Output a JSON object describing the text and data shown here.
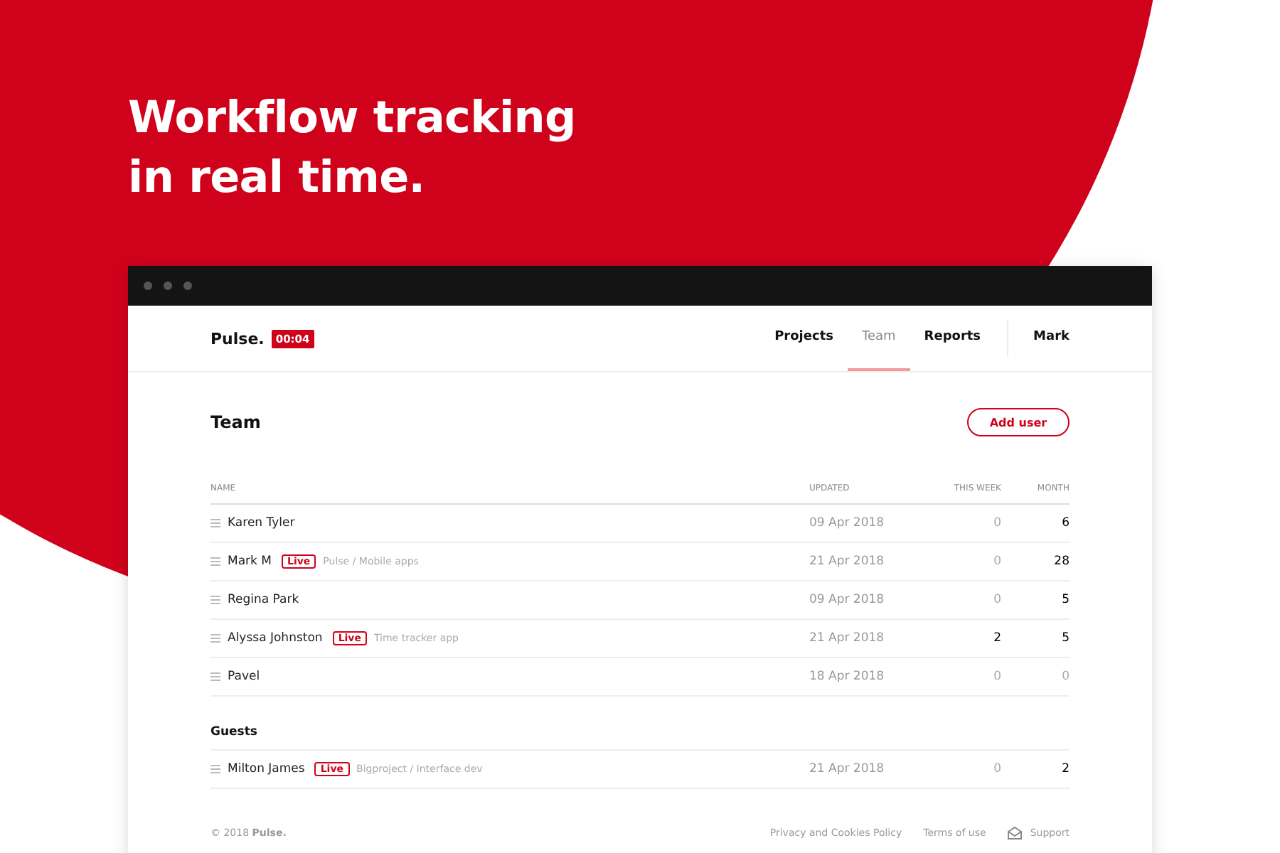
{
  "headline": [
    "Workflow tracking",
    "in real time."
  ],
  "app": {
    "brand": "Pulse.",
    "timer": "00:04",
    "nav": [
      {
        "label": "Projects",
        "selected": false
      },
      {
        "label": "Team",
        "selected": true
      },
      {
        "label": "Reports",
        "selected": false
      }
    ],
    "user": "Mark",
    "page_title": "Team",
    "add_button": "Add user",
    "columns": [
      "NAME",
      "UPDATED",
      "THIS WEEK",
      "MONTH"
    ],
    "rows": [
      {
        "name": "Karen Tyler",
        "live": false,
        "updated": "09 Apr 2018",
        "week": {
          "value": "0",
          "muted": true
        },
        "month": {
          "value": "6",
          "muted": false
        }
      },
      {
        "name": "Mark M",
        "live": true,
        "badge": "Live",
        "project": "Pulse / Mobile apps",
        "updated": "21 Apr 2018",
        "week": {
          "value": "0",
          "muted": true
        },
        "month": {
          "value": "28",
          "muted": false
        }
      },
      {
        "name": "Regina Park",
        "live": false,
        "updated": "09 Apr 2018",
        "week": {
          "value": "0",
          "muted": true
        },
        "month": {
          "value": "5",
          "muted": false
        }
      },
      {
        "name": "Alyssa Johnston",
        "live": true,
        "badge": "Live",
        "project": "Time tracker app",
        "updated": "21 Apr 2018",
        "week": {
          "value": "2",
          "muted": false
        },
        "month": {
          "value": "5",
          "muted": false
        }
      },
      {
        "name": "Pavel",
        "live": false,
        "updated": "18 Apr 2018",
        "week": {
          "value": "0",
          "muted": true
        },
        "month": {
          "value": "0",
          "muted": true
        }
      }
    ],
    "guests_title": "Guests",
    "guests": [
      {
        "name": "Milton James",
        "live": true,
        "badge": "Live",
        "project": "Bigproject / Interface dev",
        "updated": "21 Apr 2018",
        "week": {
          "value": "0",
          "muted": true
        },
        "month": {
          "value": "2",
          "muted": false
        }
      }
    ],
    "footer": {
      "copyright": "© 2018 **Pulse.**",
      "links": [
        "Privacy and Cookies Policy",
        "Terms of use"
      ],
      "support": "Support"
    }
  }
}
